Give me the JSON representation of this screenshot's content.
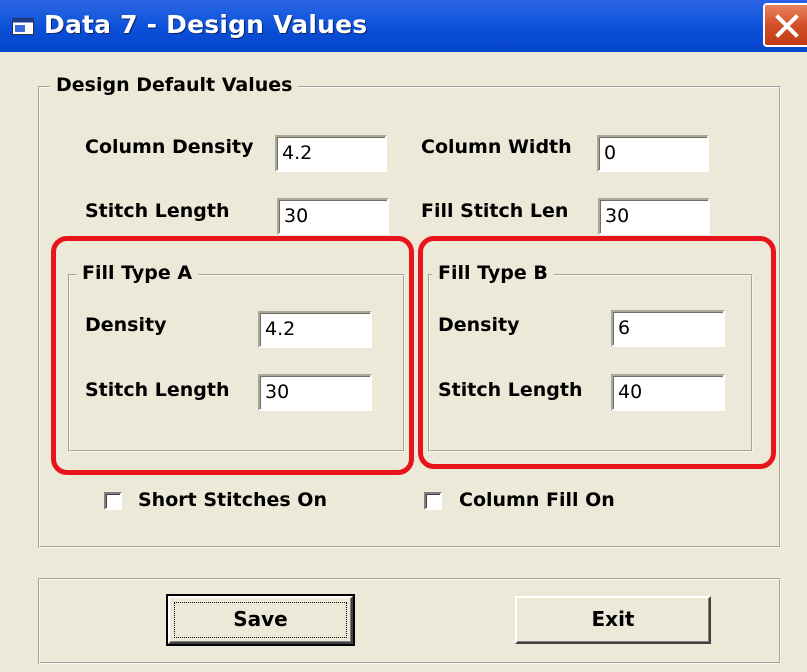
{
  "window": {
    "title": "Data 7 - Design Values"
  },
  "design_defaults": {
    "title": "Design Default Values",
    "column_density": {
      "label": "Column Density",
      "value": "4.2"
    },
    "column_width": {
      "label": "Column Width",
      "value": "0"
    },
    "stitch_length": {
      "label": "Stitch Length",
      "value": "30"
    },
    "fill_stitch_len": {
      "label": "Fill Stitch Len",
      "value": "30"
    }
  },
  "fill_type_a": {
    "title": "Fill Type A",
    "density": {
      "label": "Density",
      "value": "4.2"
    },
    "stitch_length": {
      "label": "Stitch Length",
      "value": "30"
    }
  },
  "fill_type_b": {
    "title": "Fill Type B",
    "density": {
      "label": "Density",
      "value": "6"
    },
    "stitch_length": {
      "label": "Stitch Length",
      "value": "40"
    }
  },
  "checkboxes": {
    "short_stitches": {
      "label": "Short Stitches On",
      "checked": false
    },
    "column_fill": {
      "label": "Column Fill On",
      "checked": false
    }
  },
  "buttons": {
    "save": "Save",
    "exit": "Exit"
  },
  "colors": {
    "title_bar": "#0545C9",
    "highlight": "#E8141B",
    "dialog_bg": "#ECE9D8"
  },
  "icons": {
    "title": "window-app-icon",
    "close": "close-icon"
  }
}
